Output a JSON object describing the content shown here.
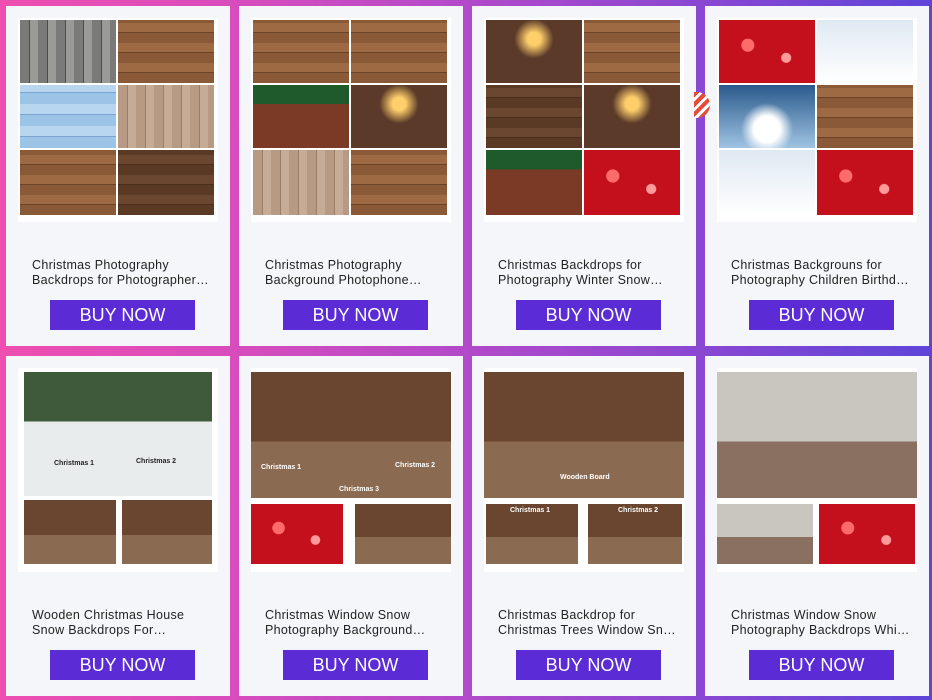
{
  "button_label": "BUY NOW",
  "products": [
    {
      "line1": "Christmas Photography",
      "line2": "Backdrops for Photographer…"
    },
    {
      "line1": "Christmas Photography",
      "line2": "Background Photophone…"
    },
    {
      "line1": "Christmas Backdrops for",
      "line2": "Photography Winter Snow…"
    },
    {
      "line1": "Christmas Backgrouns for",
      "line2": "Photography Children Birthd…"
    },
    {
      "line1": "Wooden Christmas House",
      "line2": "Snow Backdrops For…",
      "image_labels": [
        "Christmas 1",
        "Christmas 2"
      ]
    },
    {
      "line1": "Christmas Window Snow",
      "line2": "Photography Background…",
      "image_labels": [
        "Christmas 1",
        "Christmas 2",
        "Christmas 3"
      ]
    },
    {
      "line1": "Christmas Backdrop for",
      "line2": "Christmas Trees Window Sn…",
      "image_labels": [
        "Wooden Board",
        "Christmas 1",
        "Christmas 2"
      ]
    },
    {
      "line1": "Christmas Window Snow",
      "line2": "Photography Backdrops Whi…"
    }
  ],
  "colors": {
    "button": "#5b2bd6",
    "card": "#f5f6f9"
  }
}
